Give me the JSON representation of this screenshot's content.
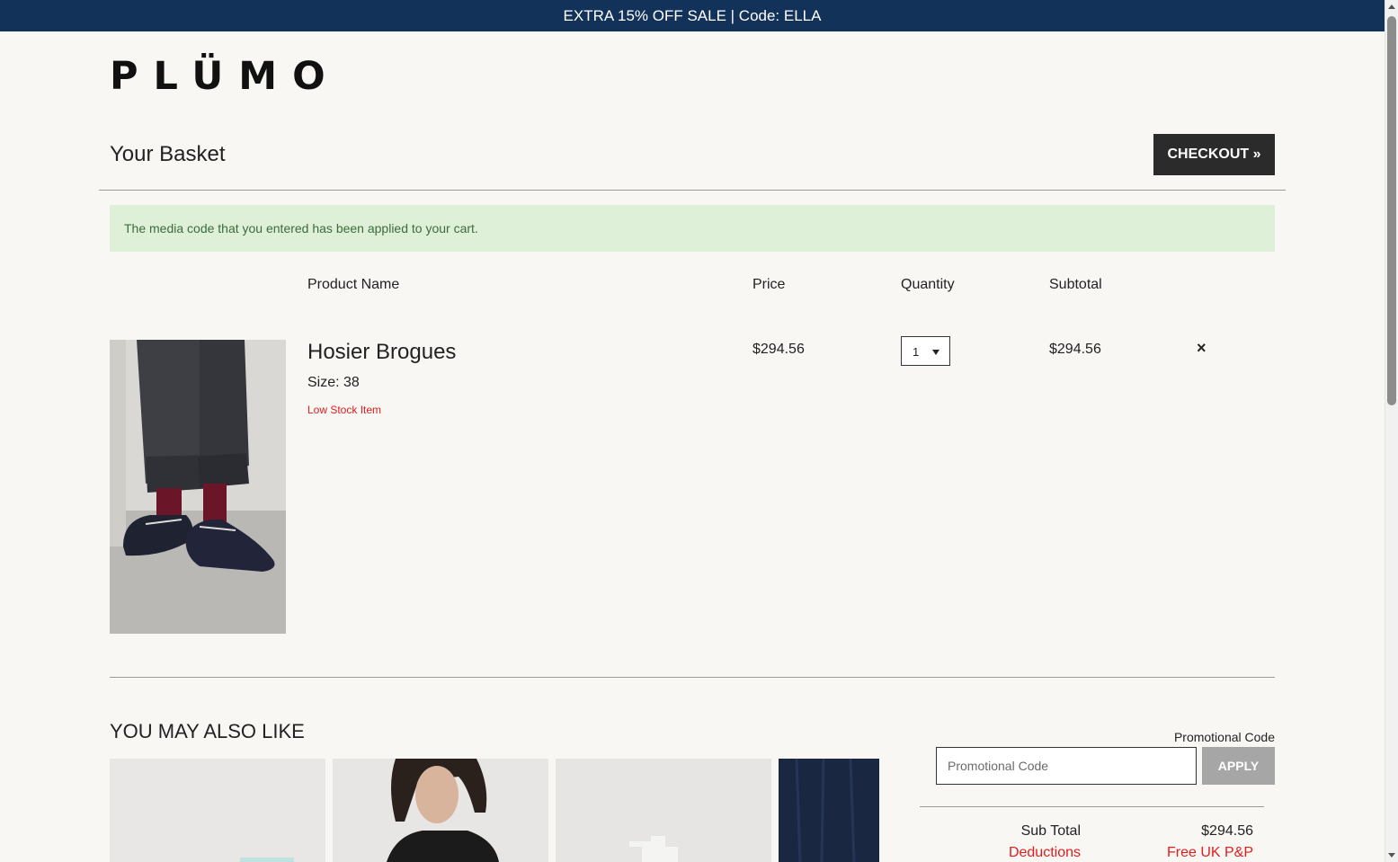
{
  "promo_bar": {
    "text": "EXTRA 15% OFF SALE | Code: ELLA"
  },
  "header": {
    "logo": "PLÜMO"
  },
  "basket": {
    "title": "Your Basket",
    "checkout_label": "CHECKOUT »",
    "alert": "The media code that you entered has been applied to your cart.",
    "columns": [
      "Product Name",
      "Price",
      "Quantity",
      "Subtotal"
    ],
    "items": [
      {
        "name": "Hosier Brogues",
        "size": "Size: 38",
        "stock": "Low Stock Item",
        "price": "$294.56",
        "quantity": "1",
        "subtotal": "$294.56",
        "remove": "×"
      }
    ]
  },
  "recommendations": {
    "title": "YOU MAY ALSO LIKE"
  },
  "promo": {
    "label": "Promotional Code",
    "placeholder": "Promotional Code",
    "apply_label": "APPLY"
  },
  "summary": {
    "rows": [
      {
        "label": "Sub Total",
        "value": "$294.56"
      },
      {
        "label": "Deductions",
        "value": "Free UK P&P"
      }
    ]
  },
  "colors": {
    "promo_bar": "#13325a",
    "checkout": "#2b2b2b",
    "alert_bg": "#dff0d8",
    "alert_text": "#3c6b3a",
    "warning": "#e11d1d",
    "apply": "#a6a6a6"
  }
}
